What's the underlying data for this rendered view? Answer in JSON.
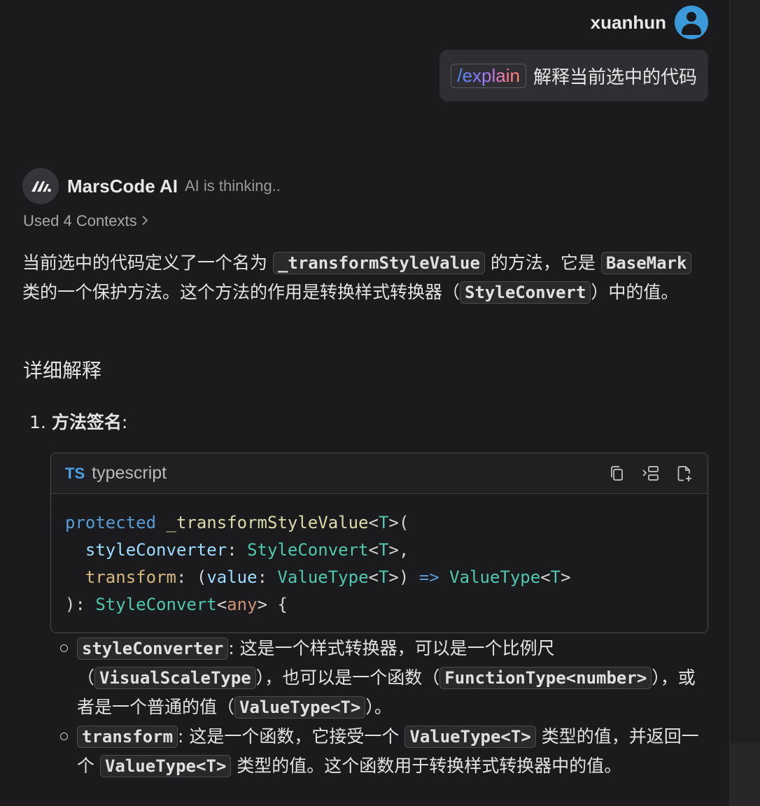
{
  "user": {
    "name": "xuanhun",
    "command": "/explain",
    "message": "解释当前选中的代码"
  },
  "ai": {
    "name": "MarsCode AI",
    "status": "AI is thinking..",
    "contexts_label": "Used 4 Contexts"
  },
  "response": {
    "intro": {
      "t1": "当前选中的代码定义了一个名为 ",
      "c1": "_transformStyleValue",
      "t2": " 的方法，它是 ",
      "c2": "BaseMark",
      "t3": " 类的一个保护方法。这个方法的作用是转换样式转换器（",
      "c3": "StyleConvert",
      "t4": "）中的值。"
    },
    "heading": "详细解释",
    "list_item_1": {
      "number": "1.",
      "label": "方法签名",
      "colon": ":"
    },
    "code_block": {
      "language_badge": "TS",
      "language": "typescript",
      "lines": [
        [
          {
            "c": "kw",
            "t": "protected"
          },
          {
            "c": "pu",
            "t": " "
          },
          {
            "c": "fn",
            "t": "_transformStyleValue"
          },
          {
            "c": "pu",
            "t": "<"
          },
          {
            "c": "ty",
            "t": "T"
          },
          {
            "c": "pu",
            "t": ">("
          }
        ],
        [
          {
            "c": "pu",
            "t": "  "
          },
          {
            "c": "pa",
            "t": "styleConverter"
          },
          {
            "c": "pu",
            "t": ": "
          },
          {
            "c": "ty",
            "t": "StyleConvert"
          },
          {
            "c": "pu",
            "t": "<"
          },
          {
            "c": "ty",
            "t": "T"
          },
          {
            "c": "pu",
            "t": ">,"
          }
        ],
        [
          {
            "c": "pu",
            "t": "  "
          },
          {
            "c": "kw2",
            "t": "transform"
          },
          {
            "c": "pu",
            "t": ": ("
          },
          {
            "c": "pa",
            "t": "value"
          },
          {
            "c": "pu",
            "t": ": "
          },
          {
            "c": "ty",
            "t": "ValueType"
          },
          {
            "c": "pu",
            "t": "<"
          },
          {
            "c": "ty",
            "t": "T"
          },
          {
            "c": "pu",
            "t": ">) "
          },
          {
            "c": "ar",
            "t": "=>"
          },
          {
            "c": "pu",
            "t": " "
          },
          {
            "c": "ty",
            "t": "ValueType"
          },
          {
            "c": "pu",
            "t": "<"
          },
          {
            "c": "ty",
            "t": "T"
          },
          {
            "c": "pu",
            "t": ">"
          }
        ],
        [
          {
            "c": "pu",
            "t": "): "
          },
          {
            "c": "ty",
            "t": "StyleConvert"
          },
          {
            "c": "pu",
            "t": "<"
          },
          {
            "c": "an",
            "t": "any"
          },
          {
            "c": "pu",
            "t": "> {"
          }
        ]
      ]
    },
    "bullet_1": {
      "c1": "styleConverter",
      "t1": ": 这是一个样式转换器，可以是一个比例尺（",
      "c2": "VisualScaleType",
      "t2": "），也可以是一个函数（",
      "c3": "FunctionType<number>",
      "t3": "），或者是一个普通的值（",
      "c4": "ValueType<T>",
      "t4": "）。"
    },
    "bullet_2": {
      "c1": "transform",
      "t1": ": 这是一个函数，它接受一个 ",
      "c2": "ValueType<T>",
      "t2": " 类型的值，并返回一个 ",
      "c3": "ValueType<T>",
      "t3": " 类型的值。这个函数用于转换样式转换器中的值。"
    }
  }
}
